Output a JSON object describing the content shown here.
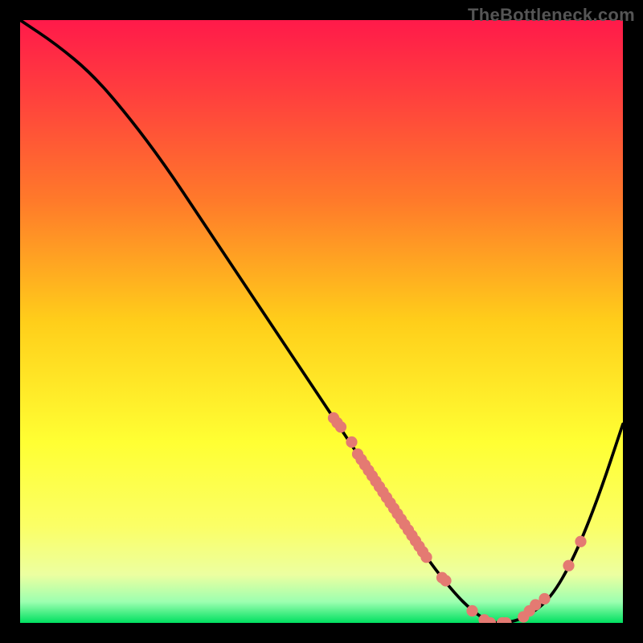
{
  "watermark": "TheBottleneck.com",
  "colors": {
    "background": "#000000",
    "curve": "#000000",
    "dot_fill": "#e47a72",
    "gradient": [
      {
        "offset": 0.0,
        "color": "#ff1a4a"
      },
      {
        "offset": 0.12,
        "color": "#ff3e3e"
      },
      {
        "offset": 0.3,
        "color": "#ff7a2a"
      },
      {
        "offset": 0.5,
        "color": "#ffce1a"
      },
      {
        "offset": 0.7,
        "color": "#ffff33"
      },
      {
        "offset": 0.84,
        "color": "#fbff66"
      },
      {
        "offset": 0.92,
        "color": "#ecffa0"
      },
      {
        "offset": 0.965,
        "color": "#9cffb0"
      },
      {
        "offset": 1.0,
        "color": "#00e060"
      }
    ]
  },
  "chart_data": {
    "type": "line",
    "title": "",
    "xlabel": "",
    "ylabel": "",
    "xlim": [
      0,
      100
    ],
    "ylim": [
      0,
      100
    ],
    "grid": false,
    "series": [
      {
        "name": "bottleneck-curve",
        "x": [
          0,
          6,
          12,
          18,
          24,
          30,
          36,
          42,
          48,
          52,
          56,
          60,
          64,
          68,
          72,
          75,
          78,
          81,
          84,
          88,
          92,
          96,
          100
        ],
        "y": [
          100,
          96,
          91,
          84,
          76,
          67,
          58,
          49,
          40,
          34,
          28,
          22,
          16,
          10,
          5,
          2,
          0,
          0,
          1,
          4,
          11,
          21,
          33
        ]
      }
    ],
    "dots": [
      {
        "x": 52.0,
        "y": 34.0
      },
      {
        "x": 52.6,
        "y": 33.2
      },
      {
        "x": 53.2,
        "y": 32.5
      },
      {
        "x": 55.0,
        "y": 30.0
      },
      {
        "x": 56.0,
        "y": 28.0
      },
      {
        "x": 56.6,
        "y": 27.1
      },
      {
        "x": 57.2,
        "y": 26.2
      },
      {
        "x": 57.8,
        "y": 25.3
      },
      {
        "x": 58.4,
        "y": 24.4
      },
      {
        "x": 59.0,
        "y": 23.5
      },
      {
        "x": 59.6,
        "y": 22.6
      },
      {
        "x": 60.2,
        "y": 21.7
      },
      {
        "x": 60.8,
        "y": 20.8
      },
      {
        "x": 61.4,
        "y": 19.9
      },
      {
        "x": 62.0,
        "y": 19.0
      },
      {
        "x": 62.6,
        "y": 18.1
      },
      {
        "x": 63.2,
        "y": 17.2
      },
      {
        "x": 63.8,
        "y": 16.3
      },
      {
        "x": 64.4,
        "y": 15.4
      },
      {
        "x": 65.0,
        "y": 14.5
      },
      {
        "x": 65.6,
        "y": 13.6
      },
      {
        "x": 66.2,
        "y": 12.7
      },
      {
        "x": 66.8,
        "y": 11.8
      },
      {
        "x": 67.4,
        "y": 10.9
      },
      {
        "x": 70.0,
        "y": 7.5
      },
      {
        "x": 70.6,
        "y": 7.0
      },
      {
        "x": 75.0,
        "y": 2.0
      },
      {
        "x": 77.0,
        "y": 0.5
      },
      {
        "x": 78.0,
        "y": 0.0
      },
      {
        "x": 80.0,
        "y": 0.0
      },
      {
        "x": 80.6,
        "y": 0.0
      },
      {
        "x": 83.5,
        "y": 1.0
      },
      {
        "x": 84.5,
        "y": 2.0
      },
      {
        "x": 85.5,
        "y": 3.0
      },
      {
        "x": 87.0,
        "y": 4.0
      },
      {
        "x": 91.0,
        "y": 9.5
      },
      {
        "x": 93.0,
        "y": 13.5
      }
    ]
  }
}
